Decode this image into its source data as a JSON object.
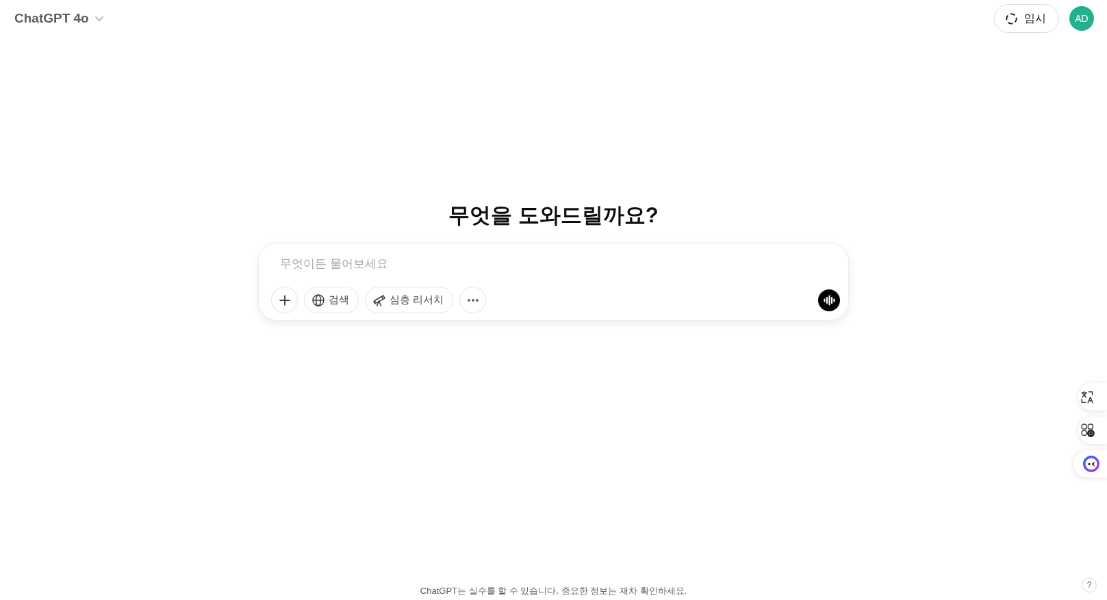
{
  "header": {
    "model_menu": {
      "label": "ChatGPT 4o"
    },
    "temporary_chat_button": {
      "label": "임시"
    },
    "avatar": {
      "initials": "AD"
    }
  },
  "greeting": "무엇을 도와드릴까요?",
  "composer": {
    "input": {
      "placeholder": "무엇이든 물어보세요"
    },
    "tools": [
      {
        "kind": "attach"
      },
      {
        "kind": "search",
        "label": "검색"
      },
      {
        "kind": "research",
        "label": "심층 리서치"
      },
      {
        "kind": "more"
      }
    ]
  },
  "footer": {
    "disclaimer": "ChatGPT는 실수를 할 수 있습니다. 중요한 정보는 재차 확인하세요.",
    "help_button": {
      "label": "?"
    }
  }
}
